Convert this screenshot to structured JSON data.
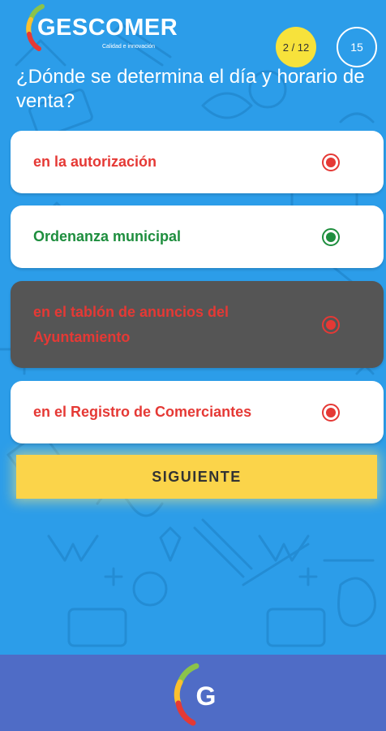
{
  "app": {
    "brand_name": "GESCOMER",
    "tagline": "Calidad e innovación",
    "footer_logo_letter": "G"
  },
  "header": {
    "progress": "2 / 12",
    "timer": "15"
  },
  "question": "¿Dónde se determina el día y horario de venta?",
  "options": [
    {
      "label": "en la autorización",
      "state": "incorrect",
      "color": "#e53935"
    },
    {
      "label": "Ordenanza municipal",
      "state": "correct",
      "color": "#1e8e3e"
    },
    {
      "label": "en el tablón de anuncios del Ayuntamiento",
      "state": "selected-incorrect",
      "color": "#e53935"
    },
    {
      "label": "en el Registro de Comerciantes",
      "state": "incorrect",
      "color": "#e53935"
    }
  ],
  "next_button": {
    "label": "SIGUIENTE"
  },
  "colors": {
    "background": "#2c9de9",
    "progress_badge": "#f7e23b",
    "next_button": "#fbd44a",
    "footer": "#4f6cc6",
    "selected_option": "#555555"
  },
  "icons": [
    "logo-arc-icon",
    "radio-icon",
    "doodle-background"
  ]
}
